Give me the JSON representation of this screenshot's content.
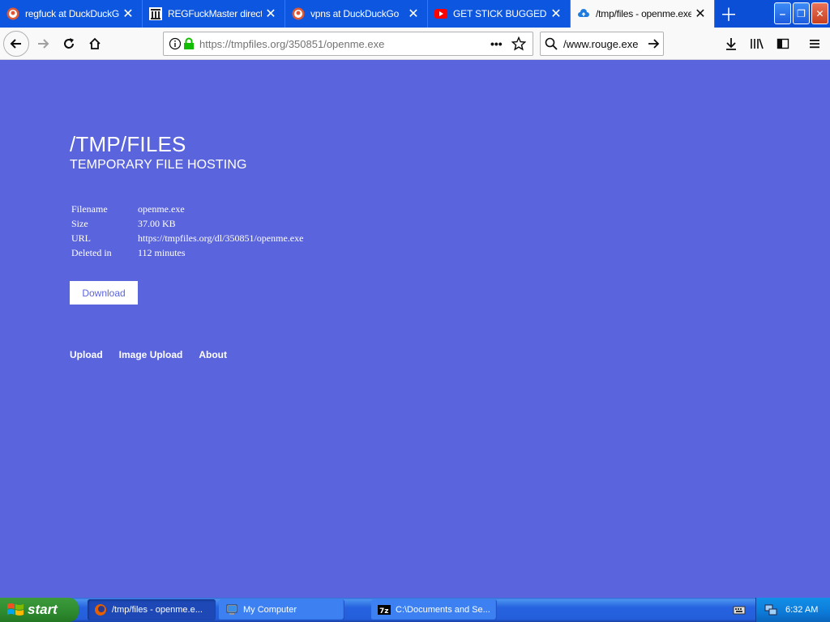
{
  "browser": {
    "tabs": [
      {
        "title": "regfuck at DuckDuckGo",
        "icon": "duckduckgo-icon"
      },
      {
        "title": "REGFuckMaster director",
        "icon": "library-icon"
      },
      {
        "title": "vpns at DuckDuckGo",
        "icon": "duckduckgo-icon"
      },
      {
        "title": "GET STICK BUGGED LO",
        "icon": "youtube-icon"
      },
      {
        "title": "/tmp/files - openme.exe",
        "icon": "cloud-icon",
        "active": true
      }
    ],
    "url": "https://tmpfiles.org/350851/openme.exe",
    "search_value": "www.rouge.exe/"
  },
  "page": {
    "title": "/TMP/FILES",
    "subtitle": "TEMPORARY FILE HOSTING",
    "file_info": [
      {
        "label": "Filename",
        "value": "openme.exe"
      },
      {
        "label": "Size",
        "value": "37.00 KB"
      },
      {
        "label": "URL",
        "value": "https://tmpfiles.org/dl/350851/openme.exe"
      },
      {
        "label": "Deleted in",
        "value": "112 minutes"
      }
    ],
    "download_label": "Download",
    "footer_links": [
      "Upload",
      "Image Upload",
      "About"
    ]
  },
  "taskbar": {
    "start_label": "start",
    "items": [
      {
        "label": "/tmp/files - openme.e...",
        "icon": "firefox-icon",
        "active": true
      },
      {
        "label": "My Computer",
        "icon": "my-computer-icon",
        "active": false
      },
      {
        "label": "C:\\Documents and Se...",
        "icon": "7zip-icon",
        "active": false
      }
    ],
    "clock": "6:32 AM"
  },
  "colors": {
    "page_background": "#5a64dc",
    "tab_strip": "#0a4fd6",
    "taskbar": "#245edb",
    "start_button": "#2e8a2e"
  }
}
